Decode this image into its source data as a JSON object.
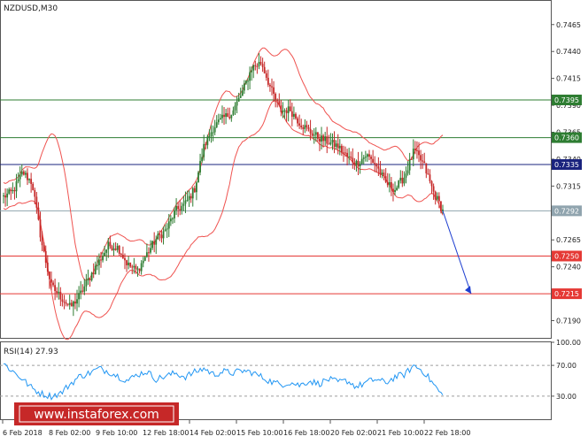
{
  "chart_data": [
    {
      "type": "candlestick",
      "title": "NZDUSD,M30",
      "y_ticks": [
        0.7465,
        0.744,
        0.7415,
        0.739,
        0.7365,
        0.734,
        0.7315,
        0.729,
        0.7265,
        0.724,
        0.7215,
        0.719
      ],
      "ylim": [
        0.7174,
        0.7487
      ],
      "x_tick_labels": [
        "6 Feb 2018",
        "8 Feb 02:00",
        "9 Feb 10:00",
        "12 Feb 18:00",
        "14 Feb 02:00",
        "15 Feb 10:00",
        "16 Feb 18:00",
        "20 Feb 02:00",
        "21 Feb 10:00",
        "22 Feb 18:00"
      ],
      "levels": [
        {
          "value": 0.7395,
          "label": "0.7395",
          "color": "#2e7d32"
        },
        {
          "value": 0.736,
          "label": "0.7360",
          "color": "#2e7d32"
        },
        {
          "value": 0.7335,
          "label": "0.7335",
          "color": "#1a237e"
        },
        {
          "value": 0.7292,
          "label": "0.7292",
          "color": "#90a4ae"
        },
        {
          "value": 0.725,
          "label": "0.7250",
          "color": "#e53935"
        },
        {
          "value": 0.7215,
          "label": "0.7215",
          "color": "#e53935"
        }
      ],
      "close_path": [
        0.7305,
        0.731,
        0.7328,
        0.7318,
        0.7262,
        0.7222,
        0.7212,
        0.7202,
        0.7214,
        0.723,
        0.7245,
        0.726,
        0.7258,
        0.7242,
        0.7236,
        0.7252,
        0.7266,
        0.7274,
        0.7292,
        0.7298,
        0.7312,
        0.7352,
        0.737,
        0.7378,
        0.7384,
        0.7402,
        0.7425,
        0.743,
        0.7405,
        0.7385,
        0.7386,
        0.7374,
        0.7366,
        0.736,
        0.7356,
        0.7352,
        0.7342,
        0.7336,
        0.7344,
        0.7335,
        0.7318,
        0.7312,
        0.7324,
        0.7348,
        0.7335,
        0.731,
        0.7292
      ],
      "projection": {
        "from": 0.7292,
        "to": 0.7215
      },
      "colors": {
        "bull": "#2e7d32",
        "bear": "#c62828",
        "bands": "#ef5350"
      }
    },
    {
      "type": "line",
      "title": "RSI(14) 27.93",
      "y_ticks": [
        100.0,
        70.0,
        30.0
      ],
      "ylim": [
        0,
        100
      ],
      "values": [
        72,
        62,
        52,
        40,
        33,
        30,
        34,
        46,
        56,
        60,
        66,
        62,
        56,
        50,
        58,
        62,
        52,
        56,
        60,
        55,
        61,
        66,
        58,
        62,
        60,
        63,
        61,
        55,
        49,
        45,
        48,
        44,
        50,
        46,
        52,
        48,
        50,
        42,
        48,
        52,
        47,
        55,
        58,
        70,
        62,
        46,
        30
      ],
      "color": "#2196f3"
    }
  ],
  "watermark": "www.instaforex.com"
}
